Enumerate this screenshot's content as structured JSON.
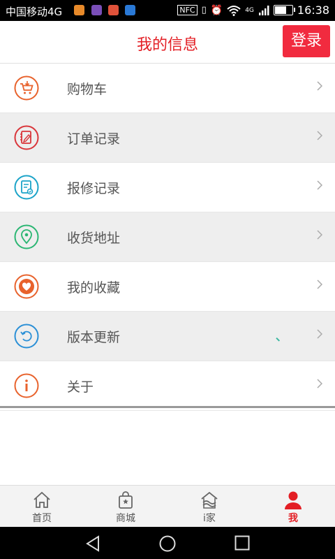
{
  "status_bar": {
    "carrier": "中国移动4G",
    "network_badge": "4G",
    "nfc": "NFC",
    "time": "16:38",
    "battery_level": 0.75,
    "notification_colors": [
      "#e88a2a",
      "#7a4fb8",
      "#e0523a",
      "#2a79d6"
    ]
  },
  "header": {
    "title": "我的信息",
    "login_label": "登录"
  },
  "menu": {
    "items": [
      {
        "label": "购物车",
        "icon": "shopping-cart-icon",
        "color": "#e8622c"
      },
      {
        "label": "订单记录",
        "icon": "order-notebook-icon",
        "color": "#d9353a"
      },
      {
        "label": "报修记录",
        "icon": "repair-clipboard-icon",
        "color": "#1aa3c8"
      },
      {
        "label": "收货地址",
        "icon": "location-pin-icon",
        "color": "#2bb673"
      },
      {
        "label": "我的收藏",
        "icon": "heart-icon",
        "color": "#e8622c"
      },
      {
        "label": "版本更新",
        "icon": "refresh-icon",
        "color": "#2a8fd6"
      },
      {
        "label": "关于",
        "icon": "info-icon",
        "color": "#e8622c"
      }
    ]
  },
  "tabbar": {
    "tabs": [
      {
        "label": "首页",
        "icon": "home-icon"
      },
      {
        "label": "商城",
        "icon": "shopping-bag-icon"
      },
      {
        "label": "i家",
        "icon": "house-wave-icon"
      },
      {
        "label": "我",
        "icon": "user-icon"
      }
    ],
    "active_index": 3,
    "active_color": "#e31e24"
  }
}
